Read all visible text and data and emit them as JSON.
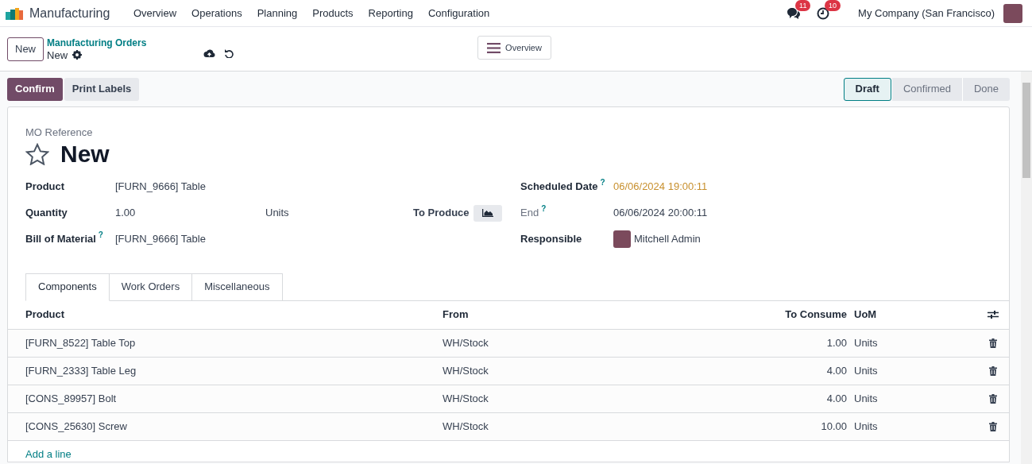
{
  "navbar": {
    "app_name": "Manufacturing",
    "menu": [
      "Overview",
      "Operations",
      "Planning",
      "Products",
      "Reporting",
      "Configuration"
    ],
    "messages_count": "11",
    "activities_count": "10",
    "company": "My Company (San Francisco)"
  },
  "control_panel": {
    "new_button": "New",
    "breadcrumb": "Manufacturing Orders",
    "record_name": "New",
    "view_button": "Overview"
  },
  "actions": [
    {
      "label": "Confirm",
      "primary": true
    },
    {
      "label": "Print Labels",
      "primary": false
    }
  ],
  "statusbar": [
    {
      "label": "Draft",
      "selected": true
    },
    {
      "label": "Confirmed",
      "selected": false
    },
    {
      "label": "Done",
      "selected": false
    }
  ],
  "form": {
    "reference_label": "MO Reference",
    "title": "New",
    "starred": false,
    "product_label": "Product",
    "product": "[FURN_9666] Table",
    "quantity_label": "Quantity",
    "quantity": "1.00",
    "quantity_uom": "Units",
    "to_produce_label": "To Produce",
    "bom_label": "Bill of Material",
    "bom_help": "?",
    "bom": "[FURN_9666] Table",
    "scheduled_label": "Scheduled Date",
    "scheduled_help": "?",
    "scheduled": "06/06/2024 19:00:11",
    "end_label": "End",
    "end_help": "?",
    "end": "06/06/2024 20:00:11",
    "responsible_label": "Responsible",
    "responsible": "Mitchell Admin"
  },
  "tabs": [
    {
      "label": "Components",
      "selected": true
    },
    {
      "label": "Work Orders",
      "selected": false
    },
    {
      "label": "Miscellaneous",
      "selected": false
    }
  ],
  "table": {
    "columns": [
      "Product",
      "From",
      "To Consume",
      "UoM"
    ],
    "rows": [
      {
        "product": "[FURN_8522] Table Top",
        "from": "WH/Stock",
        "to_consume": "1.00",
        "uom": "Units"
      },
      {
        "product": "[FURN_2333] Table Leg",
        "from": "WH/Stock",
        "to_consume": "4.00",
        "uom": "Units"
      },
      {
        "product": "[CONS_89957] Bolt",
        "from": "WH/Stock",
        "to_consume": "4.00",
        "uom": "Units"
      },
      {
        "product": "[CONS_25630] Screw",
        "from": "WH/Stock",
        "to_consume": "10.00",
        "uom": "Units"
      }
    ],
    "add_line": "Add a line"
  }
}
